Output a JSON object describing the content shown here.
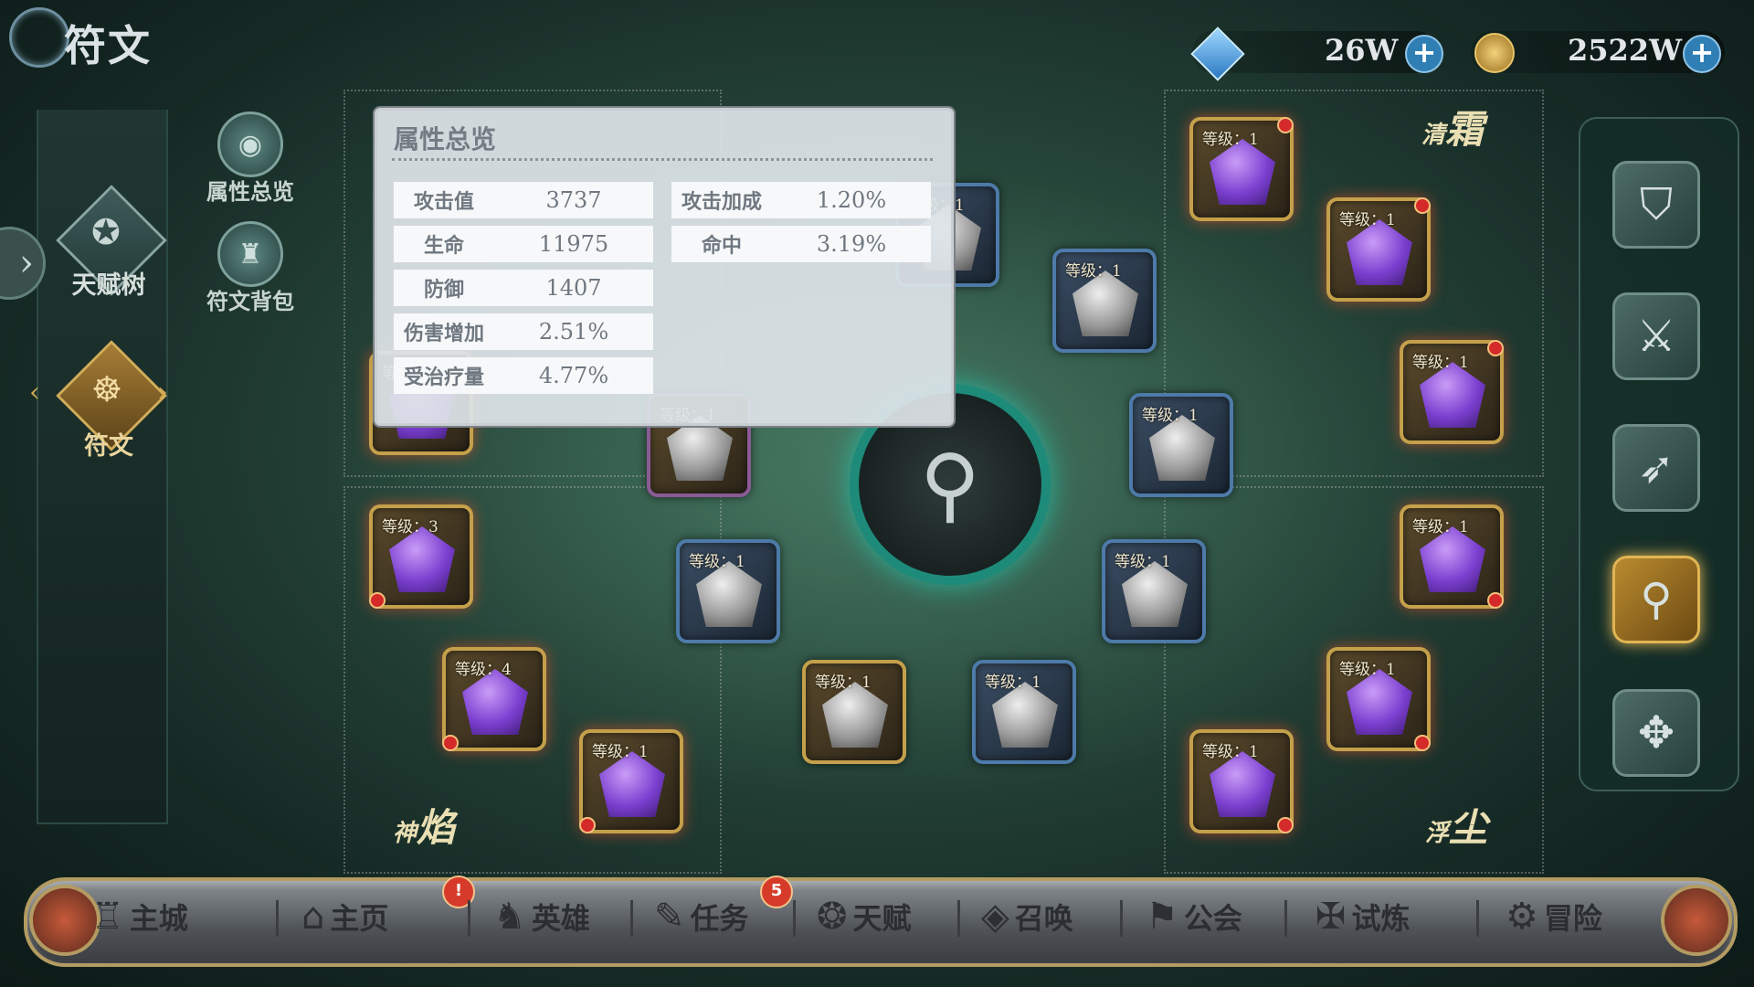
{
  "header": {
    "title": "符文"
  },
  "currency": {
    "gems": "26W",
    "gold": "2522W"
  },
  "sidebar": {
    "items": [
      {
        "label": "天赋树",
        "icon": "pentagram-icon"
      },
      {
        "label": "符文",
        "icon": "rune-icon"
      }
    ],
    "subtabs": [
      {
        "label": "属性总览",
        "icon": "eye-icon"
      },
      {
        "label": "符文背包",
        "icon": "backpack-icon"
      }
    ]
  },
  "zones": {
    "top_left": {
      "prefix": "",
      "name": ""
    },
    "top_right": {
      "prefix": "清",
      "name": "霜"
    },
    "bottom_left": {
      "prefix": "神",
      "name": "焰"
    },
    "bottom_right": {
      "prefix": "浮",
      "name": "尘"
    }
  },
  "slot_prefix": "等级：",
  "slots": {
    "s1": {
      "level": "1"
    },
    "s2": {
      "level": "1"
    },
    "s3": {
      "level": "1"
    },
    "s4": {
      "level": "3"
    },
    "s5": {
      "level": "4"
    },
    "s6": {
      "level": "1"
    },
    "s7": {
      "level": "1"
    },
    "s8": {
      "level": "1"
    },
    "s9": {
      "level": "1"
    },
    "s10": {
      "level": "1"
    },
    "s11": {
      "level": "1"
    },
    "s12": {
      "level": "1"
    },
    "s13": {
      "level": "1"
    },
    "s14": {
      "level": "1"
    },
    "s15": {
      "level": "1"
    },
    "s16": {
      "level": "1"
    },
    "s17": {
      "level": "1"
    },
    "s18": {
      "level": "1"
    }
  },
  "popup": {
    "title": "属性总览",
    "stats_left": [
      {
        "name": "攻击值",
        "value": "3737"
      },
      {
        "name": "生命",
        "value": "11975"
      },
      {
        "name": "防御",
        "value": "1407"
      },
      {
        "name": "伤害增加",
        "value": "2.51%"
      },
      {
        "name": "受治疗量",
        "value": "4.77%"
      }
    ],
    "stats_right": [
      {
        "name": "攻击加成",
        "value": "1.20%"
      },
      {
        "name": "命中",
        "value": "3.19%"
      }
    ]
  },
  "right_tools": [
    "shield-icon",
    "sword-icon",
    "bow-icon",
    "rune-search-icon",
    "cross-icon"
  ],
  "bottom_nav": {
    "items": [
      {
        "label": "主城"
      },
      {
        "label": "主页",
        "badge": "!"
      },
      {
        "label": "英雄"
      },
      {
        "label": "任务",
        "badge": "5"
      },
      {
        "label": "天赋"
      },
      {
        "label": "召唤"
      },
      {
        "label": "公会"
      },
      {
        "label": "试炼"
      },
      {
        "label": "冒险"
      }
    ]
  },
  "colors": {
    "accent_gold": "#c4a04b",
    "teal": "#1e8b7a",
    "badge_red": "#d63b2a",
    "plus_blue": "#2f7fb5"
  }
}
